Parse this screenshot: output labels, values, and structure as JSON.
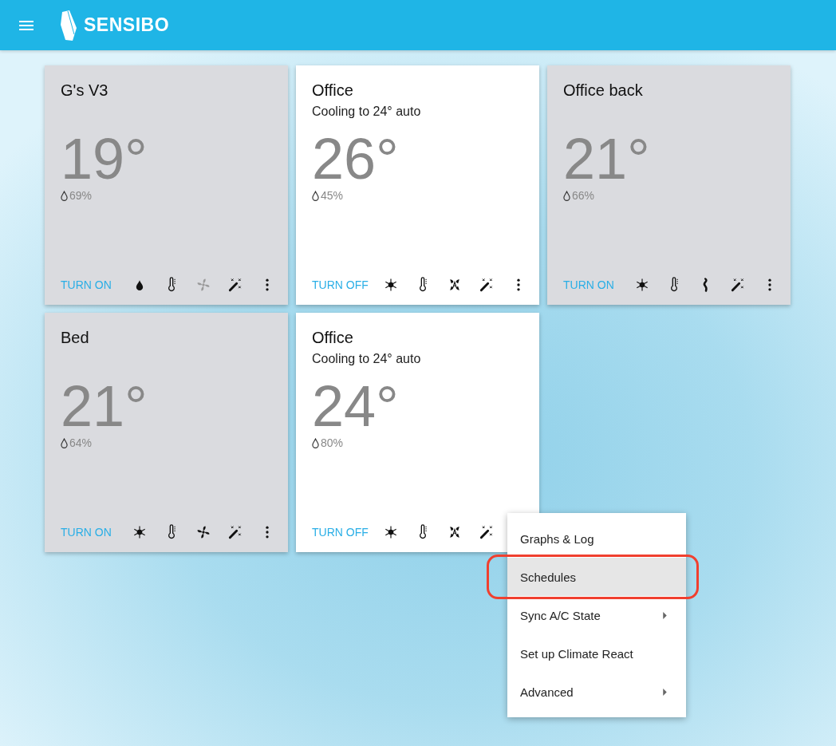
{
  "header": {
    "brand": "SENSIBO"
  },
  "devices": [
    {
      "name": "G's V3",
      "on": false,
      "temperature": "19°",
      "humidity": "69%",
      "action": "TURN ON",
      "icons": [
        {
          "kind": "drop",
          "disabled": false
        },
        {
          "kind": "thermometer",
          "disabled": false
        },
        {
          "kind": "fan",
          "disabled": true
        },
        {
          "kind": "wand",
          "disabled": false
        },
        {
          "kind": "more",
          "disabled": false
        }
      ]
    },
    {
      "name": "Office",
      "status": "Cooling to 24° auto",
      "on": true,
      "temperature": "26°",
      "humidity": "45%",
      "action": "TURN OFF",
      "icons": [
        {
          "kind": "snowflake",
          "disabled": false
        },
        {
          "kind": "thermometer",
          "disabled": false
        },
        {
          "kind": "fan-auto",
          "disabled": false
        },
        {
          "kind": "wand",
          "disabled": false
        },
        {
          "kind": "more",
          "disabled": false
        }
      ]
    },
    {
      "name": "Office back",
      "on": false,
      "temperature": "21°",
      "humidity": "66%",
      "action": "TURN ON",
      "icons": [
        {
          "kind": "snowflake",
          "disabled": false
        },
        {
          "kind": "thermometer",
          "disabled": false
        },
        {
          "kind": "swing",
          "disabled": false
        },
        {
          "kind": "wand",
          "disabled": false
        },
        {
          "kind": "more",
          "disabled": false
        }
      ]
    },
    {
      "name": "Bed",
      "on": false,
      "temperature": "21°",
      "humidity": "64%",
      "action": "TURN ON",
      "icons": [
        {
          "kind": "snowflake",
          "disabled": false
        },
        {
          "kind": "thermometer",
          "disabled": false
        },
        {
          "kind": "fan",
          "disabled": false
        },
        {
          "kind": "wand",
          "disabled": false
        },
        {
          "kind": "more",
          "disabled": false
        }
      ]
    },
    {
      "name": "Office",
      "status": "Cooling to 24° auto",
      "on": true,
      "temperature": "24°",
      "humidity": "80%",
      "action": "TURN OFF",
      "icons": [
        {
          "kind": "snowflake",
          "disabled": false
        },
        {
          "kind": "thermometer",
          "disabled": false
        },
        {
          "kind": "fan-auto",
          "disabled": false
        },
        {
          "kind": "wand",
          "disabled": false
        }
      ]
    }
  ],
  "context_menu": {
    "items": [
      {
        "label": "Graphs & Log",
        "selected": false,
        "submenu": false
      },
      {
        "label": "Schedules",
        "selected": true,
        "submenu": false
      },
      {
        "label": "Sync A/C State",
        "selected": false,
        "submenu": true
      },
      {
        "label": "Set up Climate React",
        "selected": false,
        "submenu": false
      },
      {
        "label": "Advanced",
        "selected": false,
        "submenu": true
      }
    ]
  }
}
